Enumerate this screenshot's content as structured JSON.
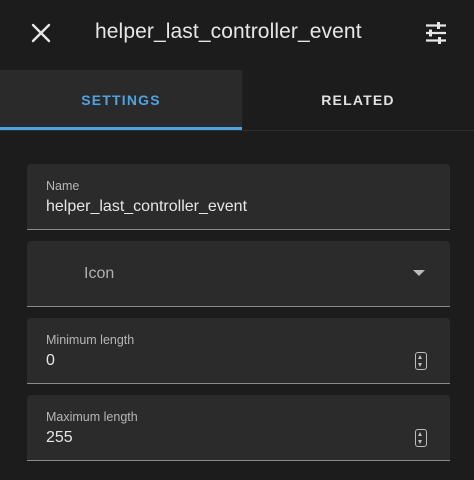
{
  "header": {
    "title": "helper_last_controller_event"
  },
  "tabs": [
    {
      "label": "SETTINGS",
      "active": true
    },
    {
      "label": "RELATED",
      "active": false
    }
  ],
  "form": {
    "name": {
      "label": "Name",
      "value": "helper_last_controller_event"
    },
    "icon": {
      "label": "Icon"
    },
    "min_length": {
      "label": "Minimum length",
      "value": "0"
    },
    "max_length": {
      "label": "Maximum length",
      "value": "255"
    }
  },
  "colors": {
    "accent": "#4fa3e0",
    "background": "#1c1c1c",
    "field_background": "#2b2b2b"
  },
  "icons": {
    "close": "close-icon",
    "tune": "tune-icon",
    "dropdown": "chevron-down-icon",
    "spinner": "spinner-icon"
  }
}
